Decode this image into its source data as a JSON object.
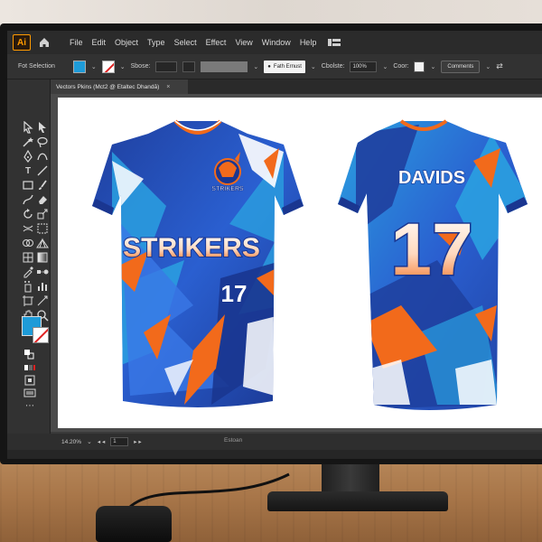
{
  "app": {
    "logo_text": "Ai",
    "menu": [
      "File",
      "Edit",
      "Object",
      "Type",
      "Select",
      "Effect",
      "View",
      "Window",
      "Help"
    ]
  },
  "control_bar": {
    "selection_label": "Fot Selection",
    "stroke_label": "Sbose:",
    "brush_dropdown": "Fath Ernust",
    "opacity_label": "Cbolste:",
    "opacity_value": "100%",
    "color_label": "Coor:",
    "comments_button": "Comments",
    "colors": {
      "fill": "#1e9bd8",
      "stroke_slash": "#e02020"
    }
  },
  "document": {
    "tab_title": "Vectors Pkins (Mct2 @ Etaltec Dhandă)",
    "tab_close": "×"
  },
  "status_bar": {
    "zoom": "14.20%",
    "page": "1",
    "center_text": "Estoan"
  },
  "artwork": {
    "front": {
      "team_name": "STRIKERS",
      "number": "17",
      "crest_text": "STRIKERS"
    },
    "back": {
      "player_name": "DAVIDS",
      "number": "17"
    },
    "colors": {
      "navy": "#1f3f9e",
      "royal": "#2a5fd0",
      "sky": "#2aa0e0",
      "orange": "#f26a1b",
      "white": "#ffffff"
    }
  }
}
